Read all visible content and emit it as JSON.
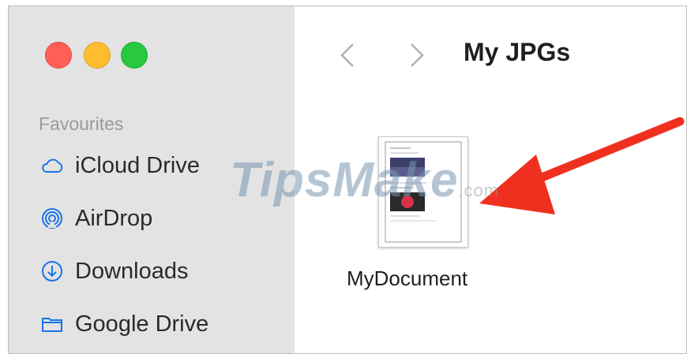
{
  "window": {
    "title": "My JPGs"
  },
  "sidebar": {
    "section_label": "Favourites",
    "items": [
      {
        "label": "iCloud Drive",
        "icon": "cloud-icon"
      },
      {
        "label": "AirDrop",
        "icon": "airdrop-icon"
      },
      {
        "label": "Downloads",
        "icon": "download-icon"
      },
      {
        "label": "Google Drive",
        "icon": "folder-icon"
      }
    ]
  },
  "files": [
    {
      "name": "MyDocument",
      "icon": "document-thumbnail"
    }
  ],
  "watermark": {
    "text": "TipsMake",
    "suffix": ".com"
  },
  "colors": {
    "close": "#ff5f57",
    "minimize": "#febc2e",
    "maximize": "#28c840",
    "accent": "#1a73e8",
    "arrow": "#f0301e",
    "sidebar_bg": "#e3e3e3"
  }
}
